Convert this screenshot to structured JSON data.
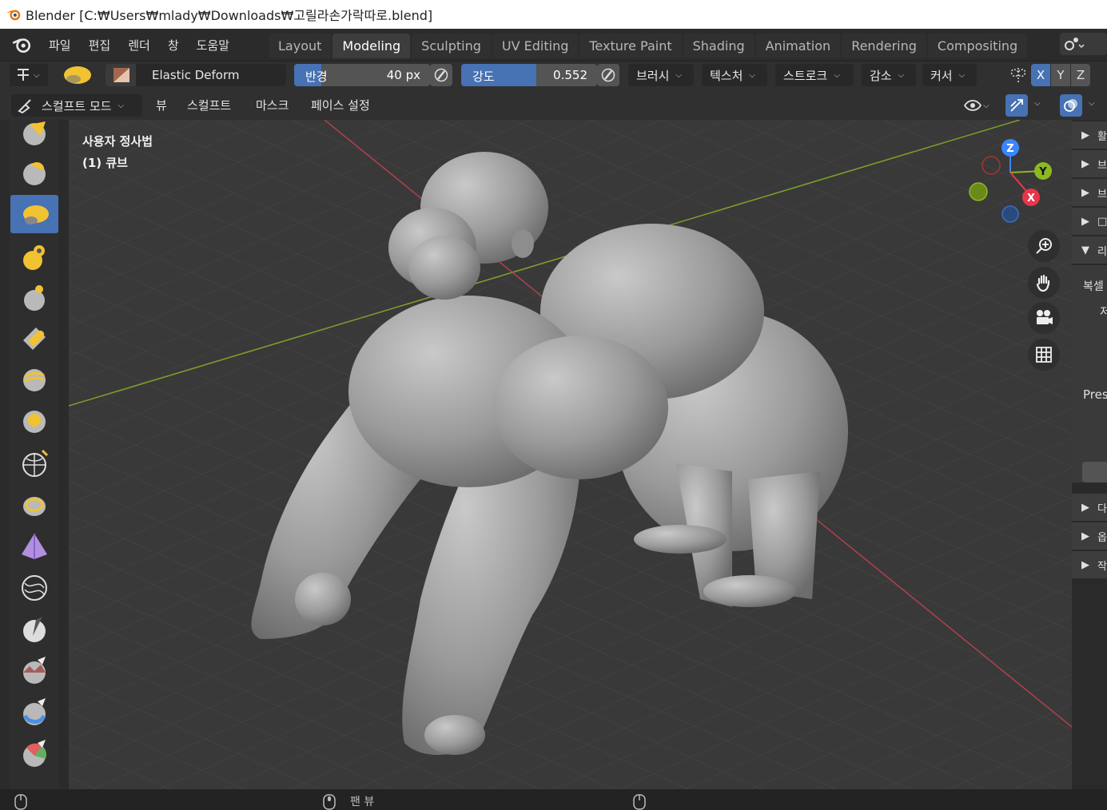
{
  "window": {
    "title": "Blender [C:₩Users₩mlady₩Downloads₩고릴라손가락따로.blend]"
  },
  "menubar": {
    "items": [
      "파일",
      "편집",
      "렌더",
      "창",
      "도움말"
    ]
  },
  "workspaces": {
    "tabs": [
      "Layout",
      "Modeling",
      "Sculpting",
      "UV Editing",
      "Texture Paint",
      "Shading",
      "Animation",
      "Rendering",
      "Compositing"
    ],
    "active": "Modeling"
  },
  "tool_header": {
    "brush_name": "Elastic Deform",
    "radius": {
      "label": "반경",
      "value": "40 px",
      "fraction": 0.2
    },
    "strength": {
      "label": "강도",
      "value": "0.552",
      "fraction": 0.552
    },
    "dropdowns": [
      "브러시",
      "텍스처",
      "스트로크",
      "감소",
      "커서"
    ],
    "symmetry_axes": [
      "X",
      "Y",
      "Z"
    ],
    "symmetry_active": "X"
  },
  "header2": {
    "mode": "스컬프트 모드",
    "menus": [
      "뷰",
      "스컬프트",
      "마스크",
      "페이스 설정"
    ]
  },
  "viewport": {
    "view_name": "사용자 정사법",
    "object_name": "(1) 큐브"
  },
  "gizmo": {
    "axes": [
      "Z",
      "Y",
      "X"
    ]
  },
  "right_panel": {
    "rows": [
      {
        "arrow": "▶",
        "text": "활"
      },
      {
        "arrow": "▶",
        "text": "브"
      },
      {
        "arrow": "▶",
        "text": "브"
      },
      {
        "arrow": "▶",
        "text": "□"
      },
      {
        "arrow": "▼",
        "text": "리"
      }
    ],
    "label_1": "복셀",
    "label_2": "저",
    "label_3": "Pres",
    "lower_rows": [
      {
        "arrow": "▶",
        "text": "다"
      },
      {
        "arrow": "▶",
        "text": "옵"
      },
      {
        "arrow": "▶",
        "text": "작"
      }
    ]
  },
  "statusbar": {
    "center": "팬 뷰"
  },
  "colors": {
    "accent": "#4772b3",
    "x_axis": "#e8354a",
    "y_axis": "#8cb822",
    "z_axis": "#3a86ff"
  }
}
